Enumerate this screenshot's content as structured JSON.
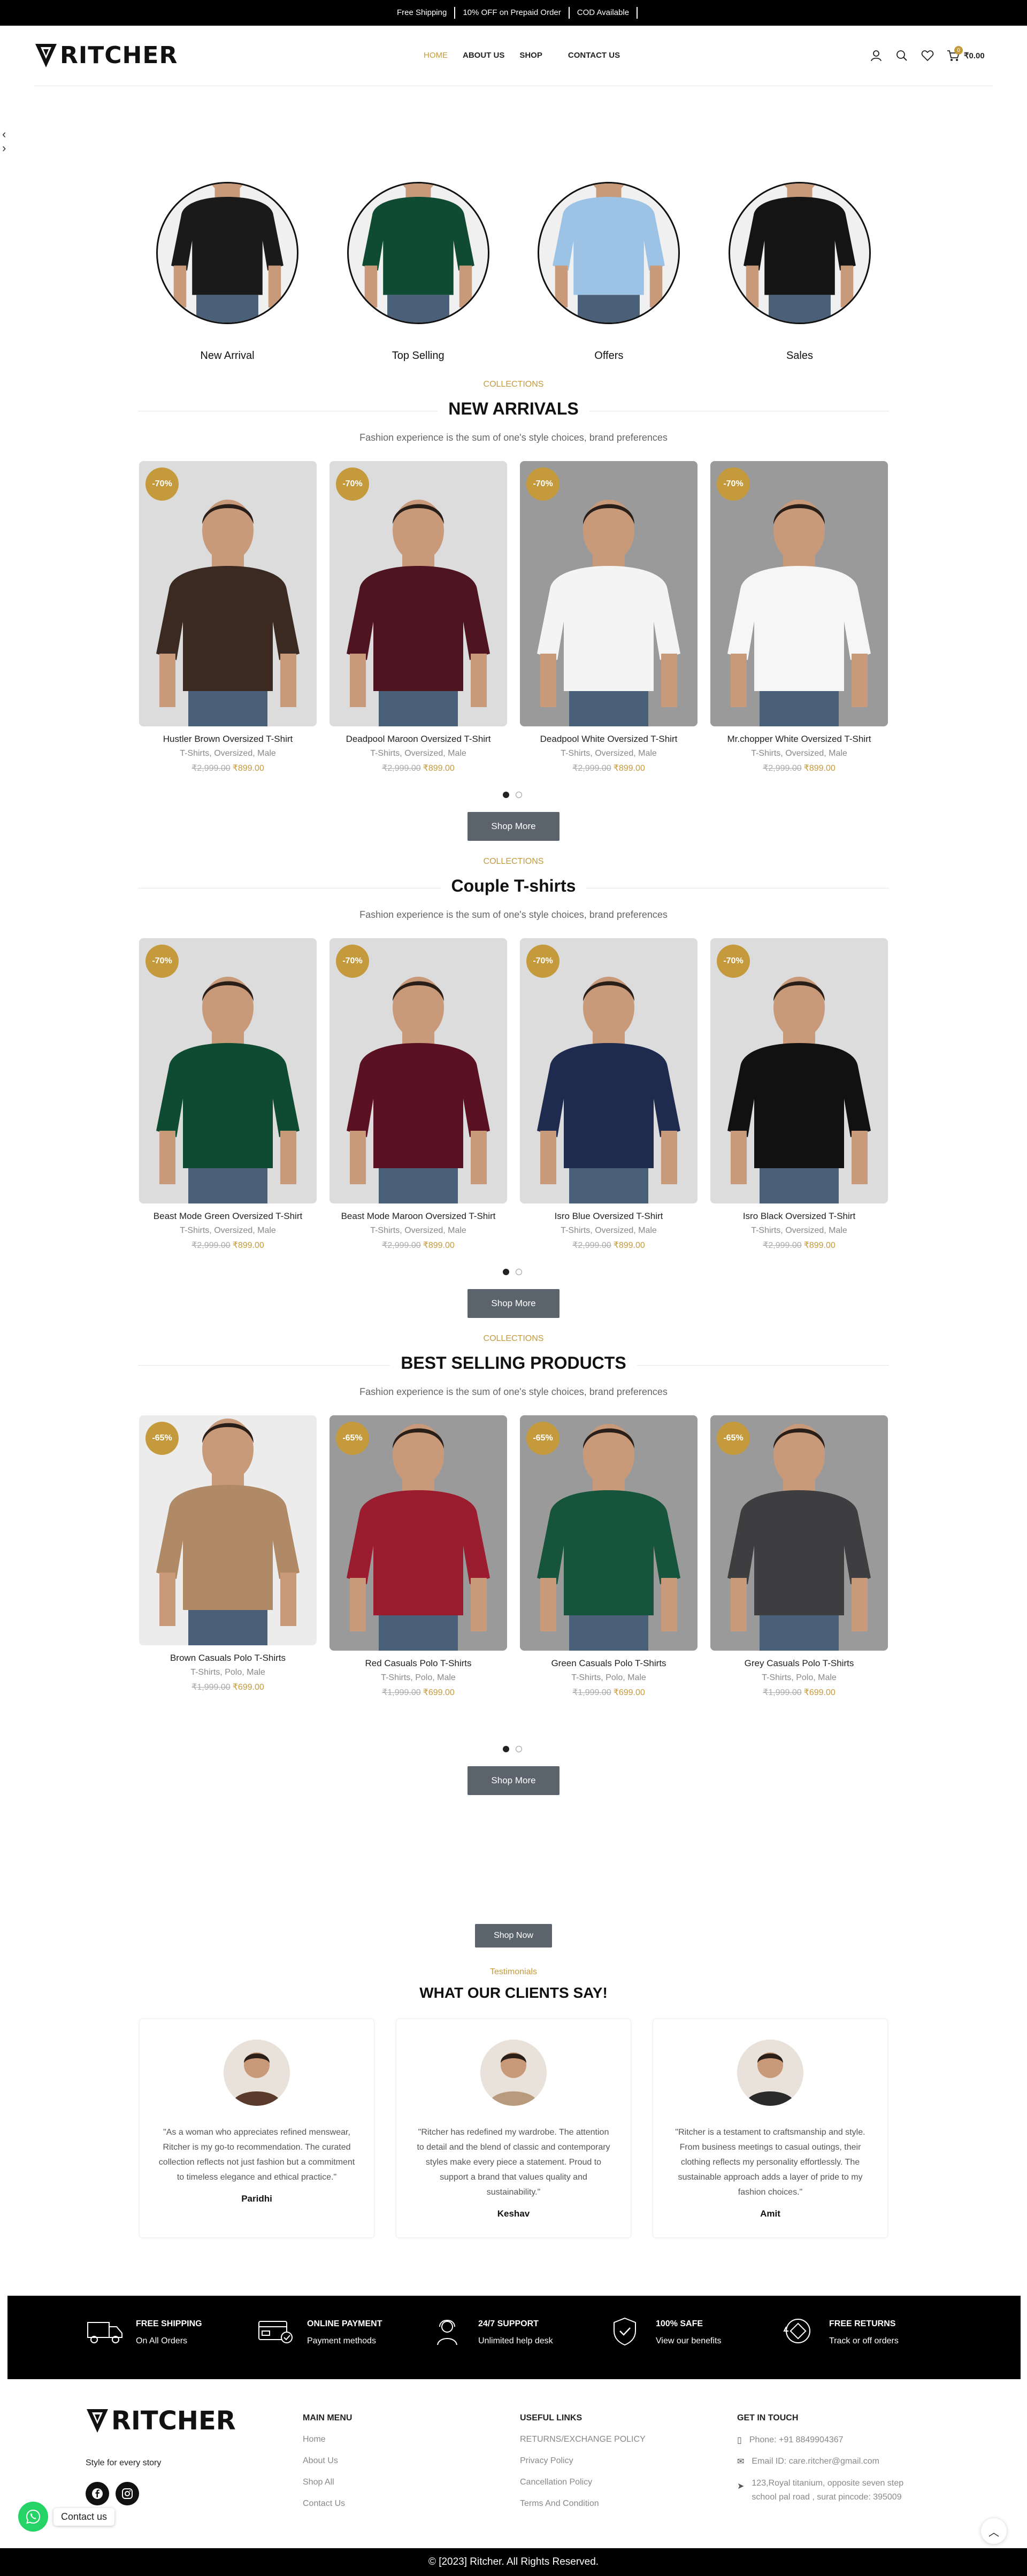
{
  "topbar": {
    "items": [
      "Free Shipping",
      "10% OFF on Prepaid Order",
      "COD Available"
    ]
  },
  "brand": {
    "name": "RITCHER",
    "tagline": "Style for every story",
    "accent": "#c49a3c"
  },
  "nav": {
    "items": [
      "HOME",
      "ABOUT US",
      "SHOP",
      "CONTACT US"
    ],
    "active": "HOME"
  },
  "header": {
    "cart_count": "0",
    "cart_total": "₹0.00"
  },
  "categories": [
    {
      "label": "New Arrival",
      "color": "#1a1a1a"
    },
    {
      "label": "Top Selling",
      "color": "#0f4b33"
    },
    {
      "label": "Offers",
      "color": "#9cc3e6"
    },
    {
      "label": "Sales",
      "color": "#141414"
    }
  ],
  "sections": [
    {
      "eyebrow": "COLLECTIONS",
      "title": "NEW ARRIVALS",
      "subtitle": "Fashion experience is the sum of one's style choices, brand preferences",
      "button": "Shop More",
      "products": [
        {
          "name": "Hustler Brown Oversized T-Shirt",
          "tags": "T-Shirts, Oversized, Male",
          "old": "₹2,999.00",
          "price": "₹899.00",
          "discount": "-70%",
          "shirt": "#3a2a22",
          "bg": "#dcdcdc"
        },
        {
          "name": "Deadpool Maroon Oversized T-Shirt",
          "tags": "T-Shirts, Oversized, Male",
          "old": "₹2,999.00",
          "price": "₹899.00",
          "discount": "-70%",
          "shirt": "#4e1420",
          "bg": "#dcdcdc"
        },
        {
          "name": "Deadpool White Oversized T-Shirt",
          "tags": "T-Shirts, Oversized, Male",
          "old": "₹2,999.00",
          "price": "₹899.00",
          "discount": "-70%",
          "shirt": "#f4f4f4",
          "bg": "#9a9a9a"
        },
        {
          "name": "Mr.chopper White Oversized T-Shirt",
          "tags": "T-Shirts, Oversized, Male",
          "old": "₹2,999.00",
          "price": "₹899.00",
          "discount": "-70%",
          "shirt": "#f6f6f6",
          "bg": "#9a9a9a"
        }
      ]
    },
    {
      "eyebrow": "COLLECTIONS",
      "title": "Couple T-shirts",
      "subtitle": "Fashion experience is the sum of one's style choices, brand preferences",
      "button": "Shop More",
      "products": [
        {
          "name": "Beast Mode Green Oversized T-Shirt",
          "tags": "T-Shirts, Oversized, Male",
          "old": "₹2,999.00",
          "price": "₹899.00",
          "discount": "-70%",
          "shirt": "#0f4b33",
          "bg": "#dcdcdc"
        },
        {
          "name": "Beast Mode Maroon Oversized T-Shirt",
          "tags": "T-Shirts, Oversized, Male",
          "old": "₹2,999.00",
          "price": "₹899.00",
          "discount": "-70%",
          "shirt": "#5a1222",
          "bg": "#dcdcdc"
        },
        {
          "name": "Isro Blue Oversized T-Shirt",
          "tags": "T-Shirts, Oversized, Male",
          "old": "₹2,999.00",
          "price": "₹899.00",
          "discount": "-70%",
          "shirt": "#1e2a4e",
          "bg": "#dcdcdc"
        },
        {
          "name": "Isro Black Oversized T-Shirt",
          "tags": "T-Shirts, Oversized, Male",
          "old": "₹2,999.00",
          "price": "₹899.00",
          "discount": "-70%",
          "shirt": "#111111",
          "bg": "#dcdcdc"
        }
      ]
    },
    {
      "eyebrow": "COLLECTIONS",
      "title": "BEST SELLING PRODUCTS",
      "subtitle": "Fashion experience is the sum of one's style choices, brand preferences",
      "button": "Shop More",
      "products": [
        {
          "name": "Brown Casuals Polo T-Shirts",
          "tags": "T-Shirts, Polo, Male",
          "old": "₹1,999.00",
          "price": "₹699.00",
          "discount": "-65%",
          "shirt": "#b08a66",
          "bg": "#ececec"
        },
        {
          "name": "Red Casuals Polo T-Shirts",
          "tags": "T-Shirts, Polo, Male",
          "old": "₹1,999.00",
          "price": "₹699.00",
          "discount": "-65%",
          "shirt": "#9b1c2e",
          "bg": "#9a9a9a"
        },
        {
          "name": "Green Casuals Polo T-Shirts",
          "tags": "T-Shirts, Polo, Male",
          "old": "₹1,999.00",
          "price": "₹699.00",
          "discount": "-65%",
          "shirt": "#16553c",
          "bg": "#9a9a9a"
        },
        {
          "name": "Grey Casuals Polo T-Shirts",
          "tags": "T-Shirts, Polo, Male",
          "old": "₹1,999.00",
          "price": "₹699.00",
          "discount": "-65%",
          "shirt": "#3e3e40",
          "bg": "#9a9a9a"
        }
      ]
    }
  ],
  "mid_button": "Shop Now",
  "testimonials": {
    "eyebrow": "Testimonials",
    "title": "WHAT OUR CLIENTS SAY!",
    "items": [
      {
        "quote": "\"As a woman who appreciates refined menswear, Ritcher is my go-to recommendation. The curated collection reflects not just fashion but a commitment to timeless elegance and ethical practice.\"",
        "name": "Paridhi",
        "tone": "#5a3a2a"
      },
      {
        "quote": "\"Ritcher has redefined my wardrobe. The attention to detail and the blend of classic and contemporary styles make every piece a statement. Proud to support a brand that values quality and sustainability.\"",
        "name": "Keshav",
        "tone": "#b89a7c"
      },
      {
        "quote": "\"Ritcher is a testament to craftsmanship and style. From business meetings to casual outings, their clothing reflects my personality effortlessly. The sustainable approach adds a layer of pride to my fashion choices.\"",
        "name": "Amit",
        "tone": "#2a2a2a"
      }
    ]
  },
  "features": [
    {
      "title": "FREE SHIPPING",
      "sub": "On All Orders",
      "icon": "truck-icon"
    },
    {
      "title": "ONLINE PAYMENT",
      "sub": "Payment methods",
      "icon": "card-icon"
    },
    {
      "title": "24/7 SUPPORT",
      "sub": "Unlimited help desk",
      "icon": "headset-icon"
    },
    {
      "title": "100% SAFE",
      "sub": "View our benefits",
      "icon": "shield-check-icon"
    },
    {
      "title": "FREE RETURNS",
      "sub": "Track or off orders",
      "icon": "return-icon"
    }
  ],
  "footer": {
    "main_menu": {
      "title": "MAIN MENU",
      "links": [
        "Home",
        "About Us",
        "Shop All",
        "Contact Us"
      ]
    },
    "useful": {
      "title": "USEFUL LINKS",
      "links": [
        "RETURNS/EXCHANGE POLICY",
        "Privacy Policy",
        "Cancellation Policy",
        "Terms And Condition"
      ]
    },
    "contact": {
      "title": "GET IN TOUCH",
      "phone": "Phone: +91 8849904367",
      "email": "Email ID: care.ritcher@gmail.com",
      "address": "123,Royal titanium, opposite seven step school pal road , surat pincode: 395009"
    },
    "copyright": "© [2023] Ritcher. All Rights Reserved."
  },
  "whatsapp": {
    "label": "Contact us"
  }
}
